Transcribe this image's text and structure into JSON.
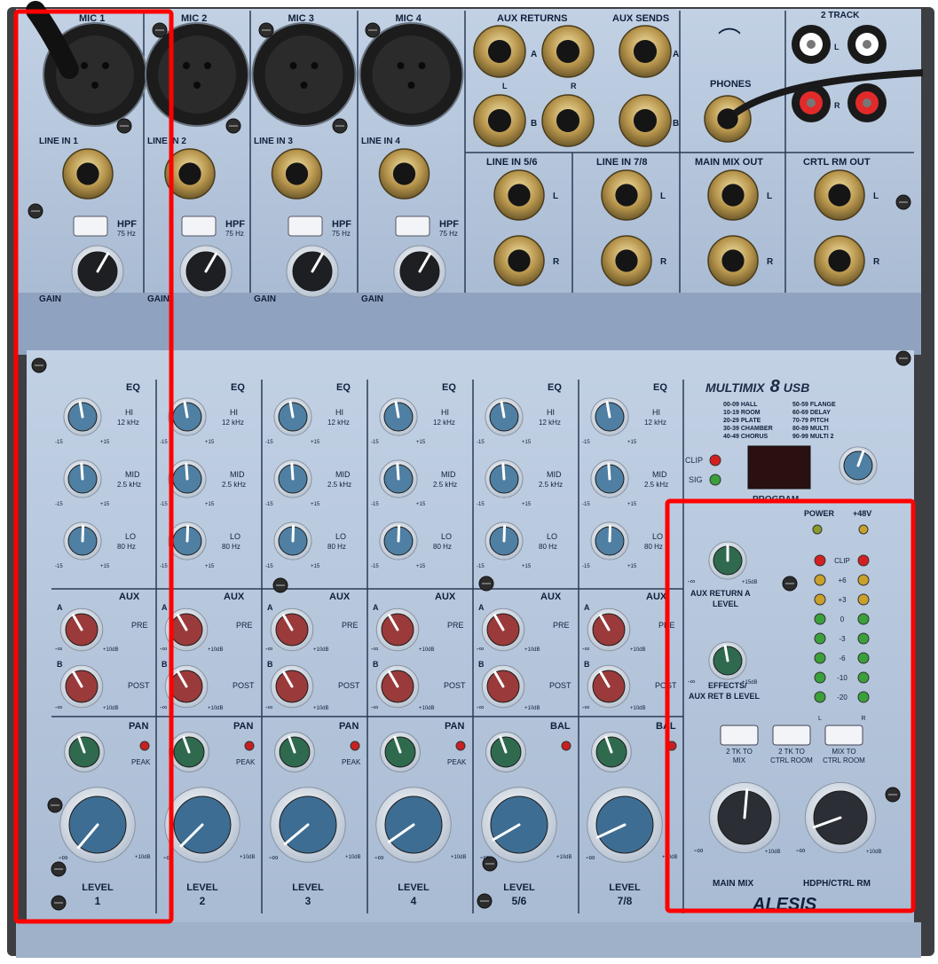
{
  "top": {
    "mic_labels": [
      "MIC 1",
      "MIC 2",
      "MIC 3",
      "MIC 4"
    ],
    "line_in_labels": [
      "LINE IN 1",
      "LINE IN 2",
      "LINE IN 3",
      "LINE IN 4"
    ],
    "hpf_label": "HPF",
    "hpf_freq": "75 Hz",
    "gain_label": "GAIN",
    "aux_returns": "AUX RETURNS",
    "aux_sends": "AUX SENDS",
    "two_track": "2 TRACK",
    "phones": "PHONES",
    "line_in_56": "LINE IN 5/6",
    "line_in_78": "LINE IN 7/8",
    "main_mix_out": "MAIN MIX OUT",
    "ctrl_rm_out": "CRTL RM OUT",
    "a": "A",
    "b": "B",
    "l": "L",
    "r": "R"
  },
  "channels": {
    "eq": "EQ",
    "hi": "HI",
    "hi_freq": "12 kHz",
    "mid": "MID",
    "mid_freq": "2.5 kHz",
    "lo": "LO",
    "lo_freq": "80 Hz",
    "eq_min": "-15",
    "eq_max": "+15",
    "aux": "AUX",
    "pre": "PRE",
    "post": "POST",
    "inf": "-∞",
    "plus10": "+10dB",
    "pan": "PAN",
    "bal": "BAL",
    "peak": "PEAK",
    "level": "LEVEL",
    "numbers": [
      "1",
      "2",
      "3",
      "4",
      "5/6",
      "7/8"
    ]
  },
  "master": {
    "brand": "MULTIMIX",
    "brand_num": "8",
    "brand_usb": "USB",
    "presets_left": [
      "00-09  HALL",
      "10-19  ROOM",
      "20-29  PLATE",
      "30-39  CHAMBER",
      "40-49  CHORUS"
    ],
    "presets_right": [
      "50-59  FLANGE",
      "60-69  DELAY",
      "70-79  PITCH",
      "80-89  MULTI",
      "90-99  MULTI 2"
    ],
    "clip": "CLIP",
    "sig": "SIG",
    "program": "PROGRAM",
    "power": "POWER",
    "phantom": "+48V",
    "meter_labels": [
      "CLIP",
      "+6",
      "+3",
      "0",
      "-3",
      "-6",
      "-10",
      "-20"
    ],
    "aux_return_a_1": "AUX RETURN A",
    "aux_return_a_2": "LEVEL",
    "effects_1": "EFFECTS/",
    "effects_2": "AUX RET B LEVEL",
    "plus15": "+15dB",
    "btn1_1": "2 TK TO",
    "btn1_2": "MIX",
    "btn2_1": "2 TK TO",
    "btn2_2": "CTRL ROOM",
    "btn3_1": "MIX TO",
    "btn3_2": "CTRL ROOM",
    "main_mix": "MAIN MIX",
    "hdph": "HDPH/CTRL RM",
    "alesis": "ALESIS"
  },
  "colors": {
    "panel": "#b4c5dc",
    "panel_dark": "#8fa2bf",
    "eq_knob": "#4f7fa3",
    "aux_knob": "#9a3a3a",
    "pan_knob": "#2f6a4e",
    "level_knob": "#3e6d93",
    "master_knob": "#2b2f35",
    "highlight": "#ff0000"
  }
}
